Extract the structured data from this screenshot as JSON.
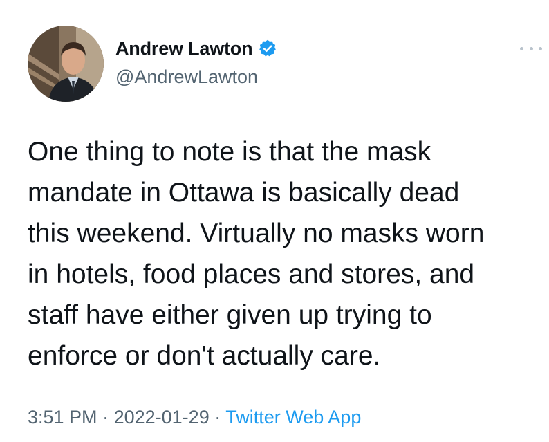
{
  "author": {
    "display_name": "Andrew Lawton",
    "handle": "@AndrewLawton",
    "verified": true
  },
  "tweet": {
    "text": "One thing to note is that the mask\nmandate in Ottawa is basically dead\nthis weekend. Virtually no masks worn\nin hotels, food places and stores, and\nstaff have either given up trying to\nenforce or don't actually care."
  },
  "meta": {
    "time": "3:51 PM",
    "separator": "·",
    "date": "2022-01-29",
    "source": "Twitter Web App"
  },
  "icons": {
    "more": "more-dots-icon",
    "verified": "verified-badge-icon"
  },
  "colors": {
    "text": "#0f1419",
    "secondary": "#536471",
    "link": "#1d9bf0",
    "verified": "#1d9bf0"
  }
}
